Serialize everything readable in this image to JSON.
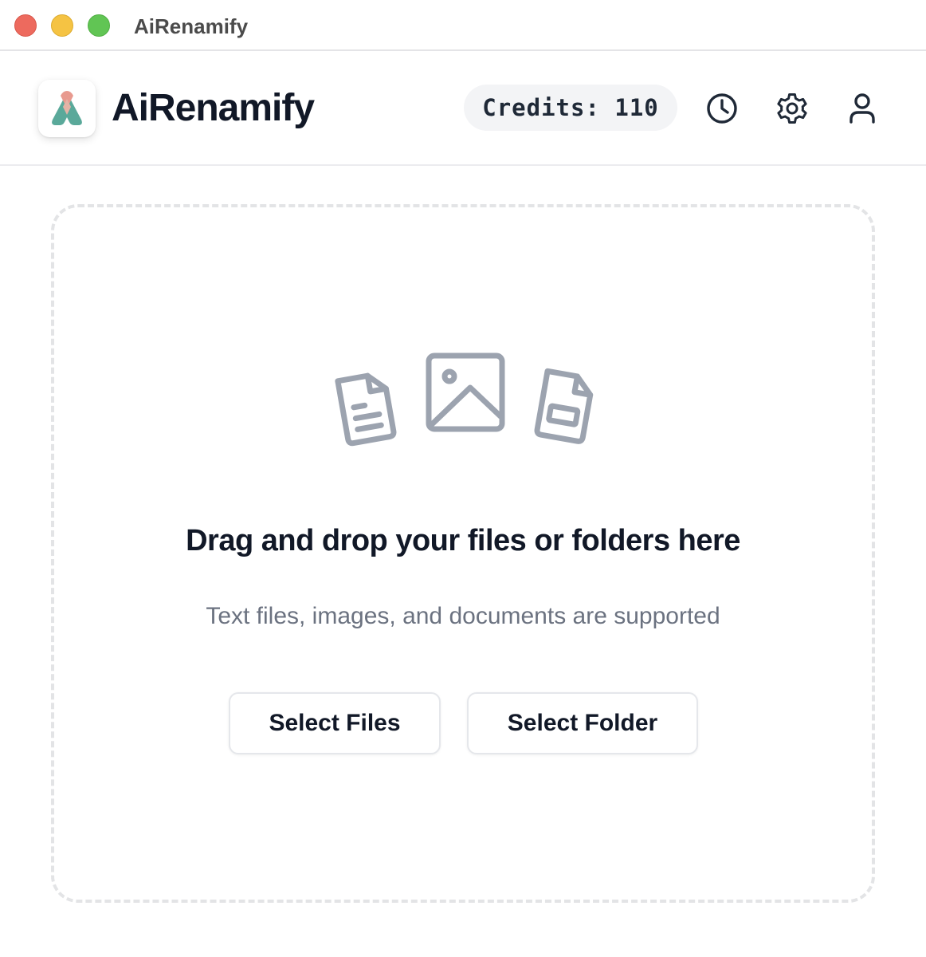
{
  "window": {
    "title": "AiRenamify",
    "controls": [
      "close",
      "minimize",
      "zoom"
    ]
  },
  "header": {
    "app_name": "AiRenamify",
    "credits_label": "Credits: 110",
    "icons": [
      "history-icon",
      "settings-icon",
      "user-icon"
    ]
  },
  "dropzone": {
    "icons": [
      "text-file-icon",
      "image-icon",
      "document-icon"
    ],
    "heading": "Drag and drop your files or folders here",
    "subtext": "Text files, images, and documents are supported",
    "select_files_label": "Select Files",
    "select_folder_label": "Select Folder"
  },
  "colors": {
    "logo_teal": "#5aa99a",
    "logo_pink": "#e89a8f",
    "icon_gray": "#9ca3af",
    "text_primary": "#111827",
    "text_secondary": "#6b7280"
  }
}
